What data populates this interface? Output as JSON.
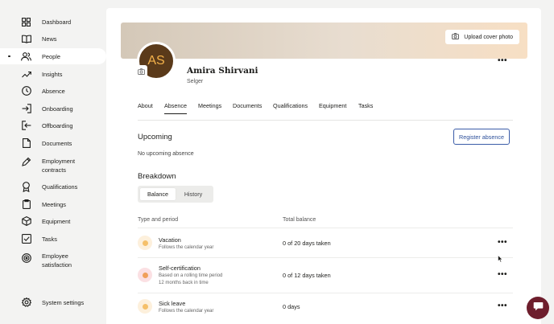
{
  "sidebar": {
    "items": [
      {
        "label": "Dashboard",
        "icon": "grid-icon"
      },
      {
        "label": "News",
        "icon": "book-icon"
      },
      {
        "label": "People",
        "icon": "people-icon",
        "active": true
      },
      {
        "label": "Insights",
        "icon": "trend-icon"
      },
      {
        "label": "Absence",
        "icon": "clock-icon"
      },
      {
        "label": "Onboarding",
        "icon": "login-icon"
      },
      {
        "label": "Offboarding",
        "icon": "logout-icon"
      },
      {
        "label": "Documents",
        "icon": "document-icon"
      },
      {
        "label_line1": "Employment",
        "label_line2": "contracts",
        "icon": "pen-icon"
      },
      {
        "label": "Qualifications",
        "icon": "award-icon"
      },
      {
        "label": "Meetings",
        "icon": "clipboard-icon"
      },
      {
        "label": "Equipment",
        "icon": "cube-icon"
      },
      {
        "label": "Tasks",
        "icon": "checkbox-icon"
      },
      {
        "label_line1": "Employee",
        "label_line2": "satisfaction",
        "icon": "target-icon"
      }
    ],
    "settings_label": "System settings"
  },
  "profile": {
    "cover_button_label": "Upload cover photo",
    "avatar_initials": "AS",
    "name": "Amira Shirvani",
    "role": "Selger",
    "more": "•••"
  },
  "tabs": [
    {
      "label": "About"
    },
    {
      "label": "Absence",
      "active": true
    },
    {
      "label": "Meetings"
    },
    {
      "label": "Documents"
    },
    {
      "label": "Qualifications"
    },
    {
      "label": "Equipment"
    },
    {
      "label": "Tasks"
    }
  ],
  "upcoming": {
    "title": "Upcoming",
    "register_label": "Register absence",
    "empty_text": "No upcoming absence"
  },
  "breakdown": {
    "title": "Breakdown",
    "segments": [
      "Balance",
      "History"
    ],
    "selected_segment": "Balance",
    "col_type": "Type and period",
    "col_balance": "Total balance",
    "rows": [
      {
        "title": "Vacation",
        "sub1": "Follows the calendar year",
        "sub2": "",
        "balance": "0 of 20 days taken",
        "color_bg": "#fdf0dc",
        "color_dot": "#f5c06a"
      },
      {
        "title": "Self-certification",
        "sub1": "Based on a rolling time period",
        "sub2": "12 months back in time",
        "balance": "0 of 12 days taken",
        "color_bg": "#fbe0e3",
        "color_dot": "#f0a05a"
      },
      {
        "title": "Sick leave",
        "sub1": "Follows the calendar year",
        "sub2": "",
        "balance": "0 days",
        "color_bg": "#fdf0dc",
        "color_dot": "#f5c06a"
      }
    ],
    "more": "•••"
  },
  "colors": {
    "accent": "#2c4f9a",
    "chat": "#6e1e2d",
    "avatar_bg": "#5a3a1a",
    "avatar_text": "#f4b24a"
  }
}
